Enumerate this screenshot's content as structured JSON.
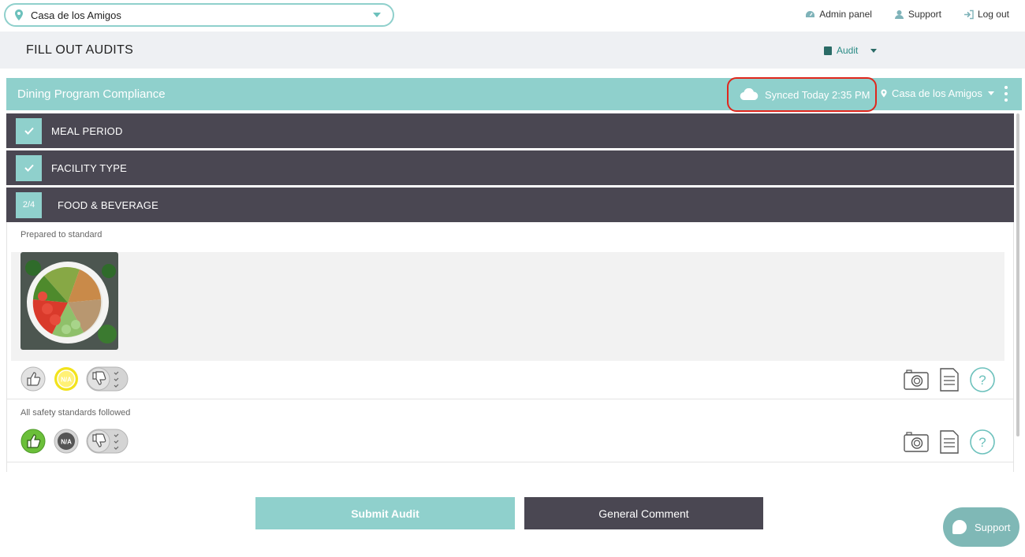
{
  "topbar": {
    "location": "Casa de los Amigos",
    "links": {
      "admin": "Admin panel",
      "support": "Support",
      "logout": "Log out"
    }
  },
  "header": {
    "title": "FILL OUT AUDITS",
    "audit_menu": "Audit"
  },
  "panel": {
    "title": "Dining Program Compliance",
    "synced": "Synced Today 2:35 PM",
    "location": "Casa de los Amigos"
  },
  "sections": [
    {
      "label": "MEAL PERIOD",
      "status": "complete"
    },
    {
      "label": "FACILITY TYPE",
      "status": "complete"
    },
    {
      "label": "FOOD & BEVERAGE",
      "progress": "2/4"
    }
  ],
  "questions": [
    {
      "label": "Prepared to standard",
      "selected": "na",
      "has_photo": true
    },
    {
      "label": "All safety standards followed",
      "selected": "pass",
      "has_photo": false
    }
  ],
  "rating_labels": {
    "na": "N/A"
  },
  "footer": {
    "submit": "Submit Audit",
    "comment": "General Comment",
    "support": "Support"
  },
  "colors": {
    "accent": "#8fd0cc",
    "dark": "#4a4752",
    "highlight": "#e0261c",
    "na_yellow": "#f2e31c",
    "pass_green": "#6bbf3a"
  }
}
